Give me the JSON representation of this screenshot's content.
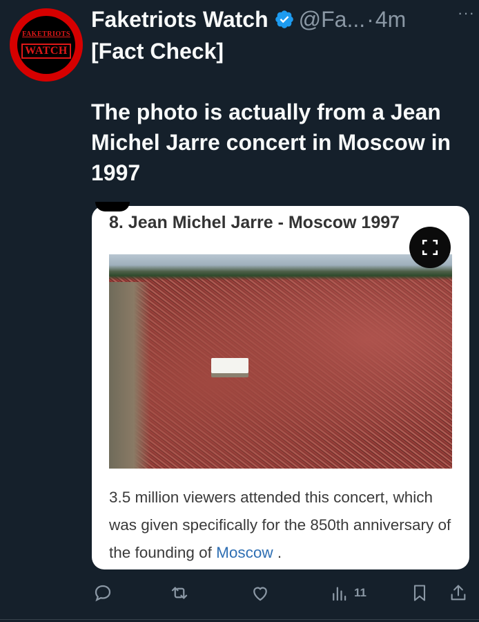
{
  "author": {
    "avatar_line1": "FAKETRIOTS",
    "avatar_line2": "WATCH",
    "display_name": "Faketriots Watch",
    "handle": "@Fa...",
    "separator": "·",
    "timestamp": "4m",
    "more_label": "···"
  },
  "tweet": {
    "heading": "[Fact Check]",
    "body": "The photo is actually from a Jean Michel Jarre concert in Moscow in 1997"
  },
  "card": {
    "title": "8. Jean Michel Jarre - Moscow 1997",
    "caption_text": "3.5 million viewers attended this concert, which was given specifically for the 850th anniversary of the founding of ",
    "caption_link": "Moscow",
    "caption_end": " ."
  },
  "actions": {
    "views_count": "11"
  },
  "colors": {
    "background": "#15202b",
    "verified": "#1d9bf0",
    "muted": "#8b98a5",
    "link": "#2f6fb3"
  }
}
